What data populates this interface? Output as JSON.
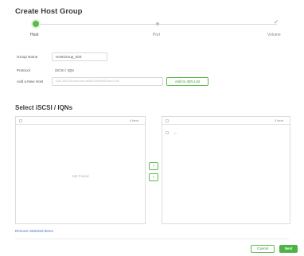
{
  "page": {
    "title": "Create Host Group"
  },
  "stepper": {
    "steps": [
      {
        "label": "Host",
        "state": "active"
      },
      {
        "label": "Port",
        "state": "pending"
      },
      {
        "label": "Volume",
        "state": "pending"
      }
    ]
  },
  "form": {
    "group_name_label": "Group Name",
    "group_name_value": "HostGroup_003",
    "protocol_label": "Protocol",
    "protocol_value": "iSCSI / IQN",
    "add_host_label": "Add a New Host",
    "add_host_placeholder": "IQN-2003-06.com.oem.ol080:01fee2000.dev1.ch0",
    "add_button_label": "Add to IQN List"
  },
  "selection": {
    "title": "Select iSCSI / IQNs",
    "left_panel": {
      "count_label": "0 Item",
      "empty_text": "Not Found"
    },
    "right_panel": {
      "count_label": "0 Item",
      "item_text": "—"
    },
    "remove_link": "Remove Selected Items"
  },
  "footer": {
    "cancel_label": "Cancel",
    "next_label": "Next"
  },
  "colors": {
    "accent": "#4db342",
    "link": "#3a6fd0"
  }
}
